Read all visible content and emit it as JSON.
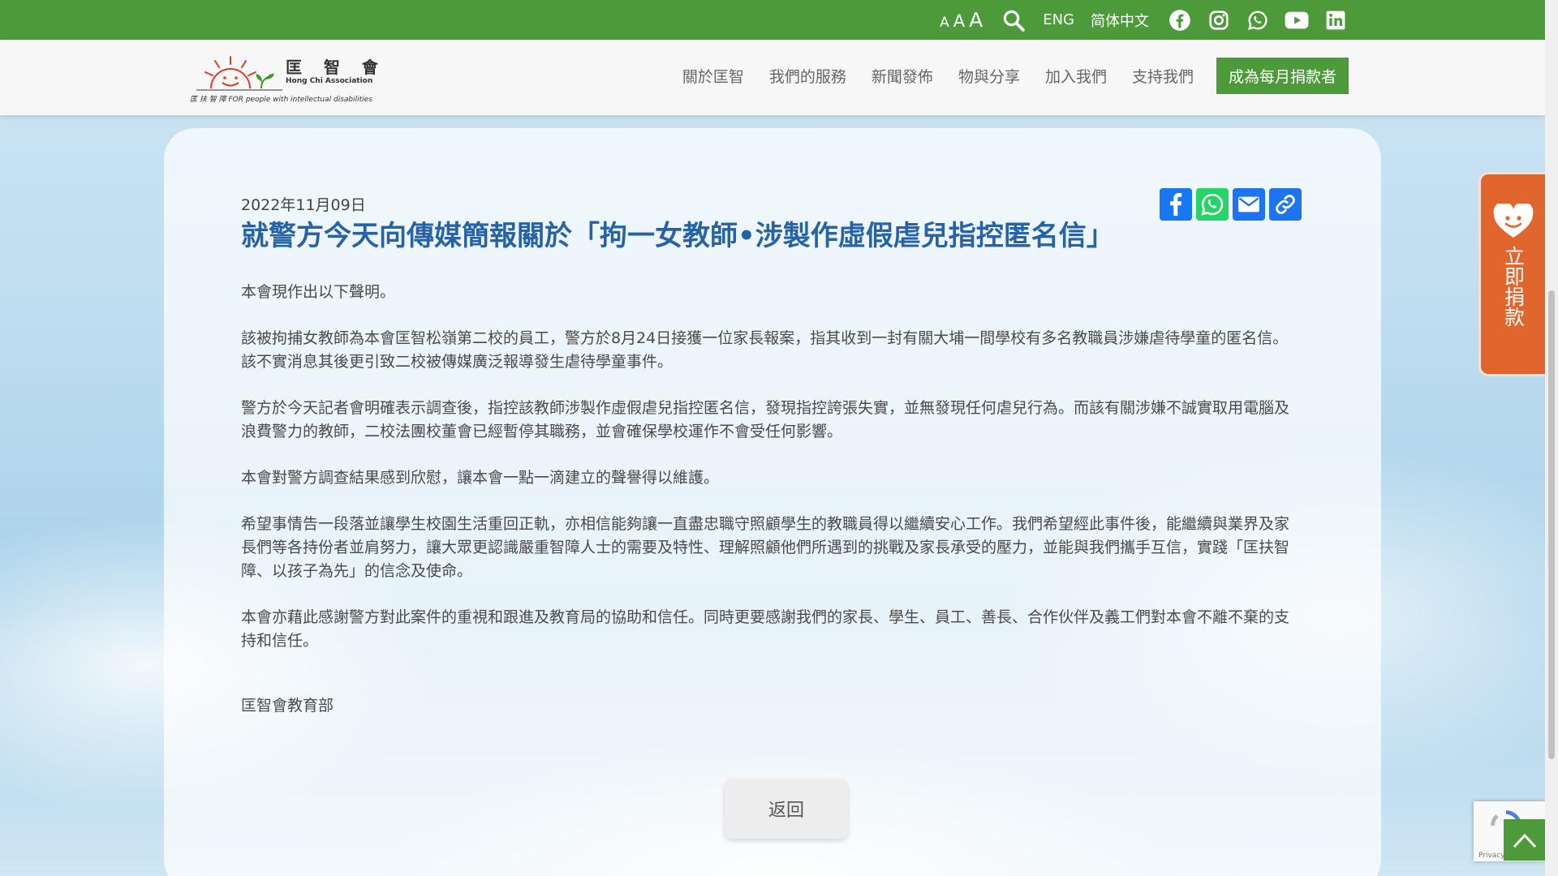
{
  "topbar": {
    "font_size_small": "A",
    "font_size_medium": "A",
    "font_size_large": "A",
    "search_icon": "search-icon",
    "lang_english": "ENG",
    "lang_simplified": "简体中文",
    "social_icons": [
      "facebook-icon",
      "instagram-icon",
      "whatsapp-icon",
      "youtube-icon",
      "linkedin-icon"
    ],
    "background_color": "#4c9a3a"
  },
  "header": {
    "logo": {
      "name": "匡 智 會",
      "english": "Hong Chi Association",
      "tagline": "匡 扶 智 障 FOR people with intellectual disabilities"
    },
    "nav": [
      {
        "label": "關於匡智"
      },
      {
        "label": "我們的服務"
      },
      {
        "label": "新聞發佈"
      },
      {
        "label": "物與分享"
      },
      {
        "label": "加入我們"
      },
      {
        "label": "支持我們"
      }
    ],
    "cta_label": "成為每月捐款者"
  },
  "article": {
    "date": "2022年11月09日",
    "title": "就警方今天向傳媒簡報關於「拘一女教師•涉製作虛假虐兒指控匿名信」",
    "share_icons": [
      "facebook-icon",
      "whatsapp-icon",
      "email-icon",
      "copy-link-icon"
    ],
    "paragraphs": [
      "本會現作出以下聲明。",
      "該被拘捕女教師為本會匡智松嶺第二校的員工，警方於8月24日接獲一位家長報案，指其收到一封有關大埔一間學校有多名教職員涉嫌虐待學童的匿名信。該不實消息其後更引致二校被傳媒廣泛報導發生虐待學童事件。",
      "警方於今天記者會明確表示調查後，指控該教師涉製作虛假虐兒指控匿名信，發現指控誇張失實，並無發現任何虐兒行為。而該有關涉嫌不誠實取用電腦及浪費警力的教師，二校法團校董會已經暫停其職務，並會確保學校運作不會受任何影響。",
      "本會對警方調查結果感到欣慰，讓本會一點一滴建立的聲譽得以維護。",
      "希望事情告一段落並讓學生校園生活重回正軌，亦相信能夠讓一直盡忠職守照顧學生的教職員得以繼續安心工作。我們希望經此事件後，能繼續與業界及家長們等各持份者並肩努力，讓大眾更認識嚴重智障人士的需要及特性、理解照顧他們所遇到的挑戰及家長承受的壓力，並能與我們攜手互信，實踐「匡扶智障、以孩子為先」的信念及使命。",
      "本會亦藉此感謝警方對此案件的重視和跟進及教育局的協助和信任。同時更要感謝我們的家長、學生、員工、善長、合作伙伴及義工們對本會不離不棄的支持和信任。"
    ],
    "signature": "匡智會教育部",
    "back_label": "返回",
    "title_color": "#2563a6"
  },
  "donate": {
    "label": "立即捐款",
    "icon": "heart-icon",
    "color": "#e0662d"
  },
  "recaptcha": {
    "footer": "Privacy - Terms"
  },
  "to_top": {
    "icon": "chevron-up-icon"
  }
}
